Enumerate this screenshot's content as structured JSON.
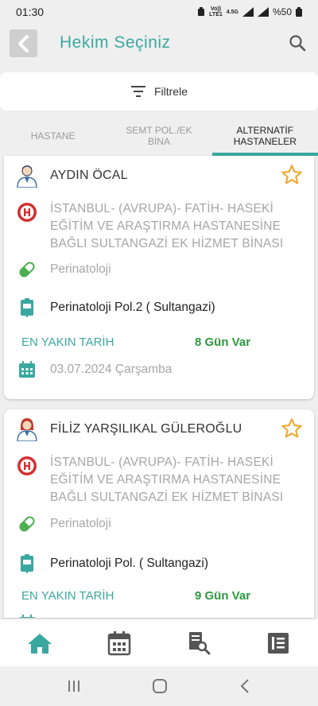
{
  "status_bar": {
    "time": "01:30",
    "network_top": "Vo))",
    "network_lte": "LTE1",
    "network_gen": "4.5G",
    "battery": "%50"
  },
  "header": {
    "title": "Hekim Seçiniz"
  },
  "filter": {
    "label": "Filtrele"
  },
  "tabs": [
    {
      "label": "HASTANE"
    },
    {
      "label": "SEMT POL./EK BİNA"
    },
    {
      "label": "ALTERNATİF HASTANELER"
    }
  ],
  "cards": [
    {
      "doctor": "AYDIN ÖCAL",
      "hospital": "İSTANBUL- (AVRUPA)- FATİH- HASEKİ EĞİTİM VE ARAŞTIRMA HASTANESİNE BAĞLI SULTANGAZİ EK HİZMET BİNASI",
      "branch": "Perinatoloji",
      "clinic": "Perinatoloji Pol.2 ( Sultangazi)",
      "nearest_label": "EN YAKIN TARİH",
      "nearest_value": "8 Gün Var",
      "date": "03.07.2024 Çarşamba"
    },
    {
      "doctor": "FİLİZ YARŞILIKAL GÜLEROĞLU",
      "hospital": "İSTANBUL- (AVRUPA)- FATİH- HASEKİ EĞİTİM VE ARAŞTIRMA HASTANESİNE BAĞLI SULTANGAZİ EK HİZMET BİNASI",
      "branch": "Perinatoloji",
      "clinic": "Perinatoloji Pol. ( Sultangazi)",
      "nearest_label": "EN YAKIN TARİH",
      "nearest_value": "9 Gün Var"
    }
  ],
  "colors": {
    "accent": "#3aa89f",
    "green": "#2b9a3e",
    "hospital_red": "#d32f2f",
    "star": "#f0a830"
  }
}
